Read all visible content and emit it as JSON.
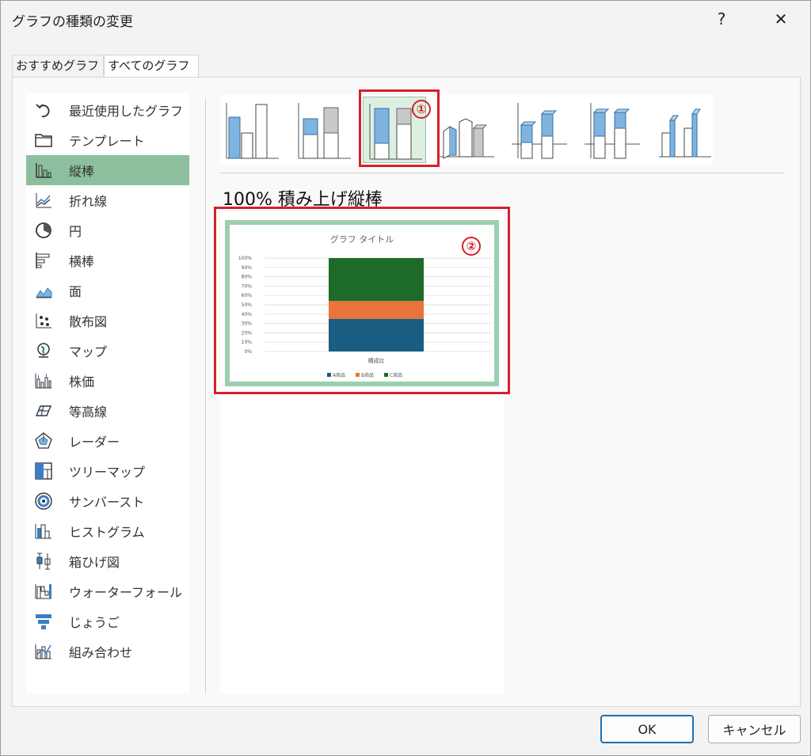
{
  "window": {
    "title": "グラフの種類の変更",
    "help_label": "?",
    "close_label": "✕"
  },
  "tabs": [
    {
      "label": "おすすめグラフ"
    },
    {
      "label": "すべてのグラフ"
    }
  ],
  "sidebar": {
    "items": [
      {
        "label": "最近使用したグラフ",
        "icon": "recent-icon"
      },
      {
        "label": "テンプレート",
        "icon": "folder-icon"
      },
      {
        "label": "縦棒",
        "icon": "column-chart-icon",
        "selected": true
      },
      {
        "label": "折れ線",
        "icon": "line-chart-icon"
      },
      {
        "label": "円",
        "icon": "pie-chart-icon"
      },
      {
        "label": "横棒",
        "icon": "bar-chart-icon"
      },
      {
        "label": "面",
        "icon": "area-chart-icon"
      },
      {
        "label": "散布図",
        "icon": "scatter-chart-icon"
      },
      {
        "label": "マップ",
        "icon": "map-chart-icon"
      },
      {
        "label": "株価",
        "icon": "stock-chart-icon"
      },
      {
        "label": "等高線",
        "icon": "surface-chart-icon"
      },
      {
        "label": "レーダー",
        "icon": "radar-chart-icon"
      },
      {
        "label": "ツリーマップ",
        "icon": "treemap-chart-icon"
      },
      {
        "label": "サンバースト",
        "icon": "sunburst-chart-icon"
      },
      {
        "label": "ヒストグラム",
        "icon": "histogram-chart-icon"
      },
      {
        "label": "箱ひげ図",
        "icon": "boxwhisker-chart-icon"
      },
      {
        "label": "ウォーターフォール",
        "icon": "waterfall-chart-icon"
      },
      {
        "label": "じょうご",
        "icon": "funnel-chart-icon"
      },
      {
        "label": "組み合わせ",
        "icon": "combo-chart-icon"
      }
    ]
  },
  "chart_types": {
    "selected_index": 2,
    "selected_name": "100% 積み上げ縦棒"
  },
  "annotations": {
    "marker1": "①",
    "marker2": "②",
    "color": "#d8202a"
  },
  "preview": {
    "chart_data": {
      "type": "bar",
      "title": "グラフ タイトル",
      "categories": [
        "構成比"
      ],
      "series": [
        {
          "name": "A商品",
          "values": [
            35
          ],
          "color": "#1b5c82"
        },
        {
          "name": "B商品",
          "values": [
            19
          ],
          "color": "#e9733a"
        },
        {
          "name": "C商品",
          "values": [
            46
          ],
          "color": "#1e6b29"
        }
      ],
      "ylim": [
        0,
        100
      ],
      "yticks": [
        "0%",
        "10%",
        "20%",
        "30%",
        "40%",
        "50%",
        "60%",
        "70%",
        "80%",
        "90%",
        "100%"
      ],
      "grid": true,
      "legend": "bottom"
    }
  },
  "buttons": {
    "ok": "OK",
    "cancel": "キャンセル"
  }
}
